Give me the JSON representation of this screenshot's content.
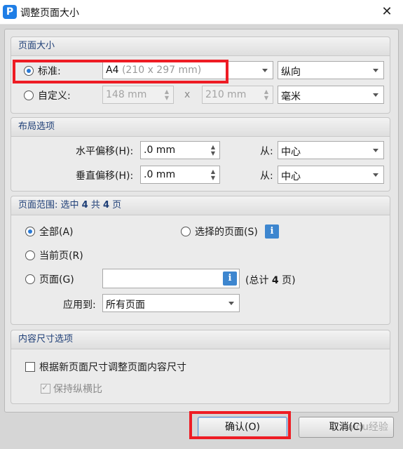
{
  "window": {
    "title": "调整页面大小",
    "app_icon_letter": "P",
    "close_glyph": "✕"
  },
  "page_size": {
    "header": "页面大小",
    "standard_label": "标准:",
    "standard_value": "A4",
    "standard_detail": "(210 x 297 mm)",
    "orientation_value": "纵向",
    "custom_label": "自定义:",
    "custom_width": "148 mm",
    "custom_height": "210 mm",
    "times_symbol": "x",
    "unit_value": "毫米"
  },
  "layout": {
    "header": "布局选项",
    "h_offset_label": "水平偏移(H):",
    "h_offset_value": ".0 mm",
    "v_offset_label": "垂直偏移(H):",
    "v_offset_value": ".0 mm",
    "from_label": "从:",
    "h_from_value": "中心",
    "v_from_value": "中心"
  },
  "page_range": {
    "header_prefix": "页面范围: 选中 ",
    "selected_count": "4",
    "header_mid": " 共 ",
    "total_count": "4",
    "header_suffix": " 页",
    "all_label": "全部(A)",
    "selected_pages_label": "选择的页面(S)",
    "current_label": "当前页(R)",
    "pages_label": "页面(G)",
    "pages_value": "",
    "total_prefix": "(总计 ",
    "total_suffix": " 页)",
    "apply_to_label": "应用到:",
    "apply_to_value": "所有页面"
  },
  "content_size": {
    "header": "内容尺寸选项",
    "resize_content_label": "根据新页面尺寸调整页面内容尺寸",
    "keep_ratio_label": "保持纵横比"
  },
  "buttons": {
    "ok_label": "确认(O)",
    "cancel_label": "取消(C)"
  },
  "icons": {
    "info": "i"
  },
  "watermark": "Baidu经验",
  "colors": {
    "highlight": "#ee1c24",
    "accent": "#2a7ad6",
    "info_button": "#3d86cf",
    "header_text": "#1f3f77"
  }
}
